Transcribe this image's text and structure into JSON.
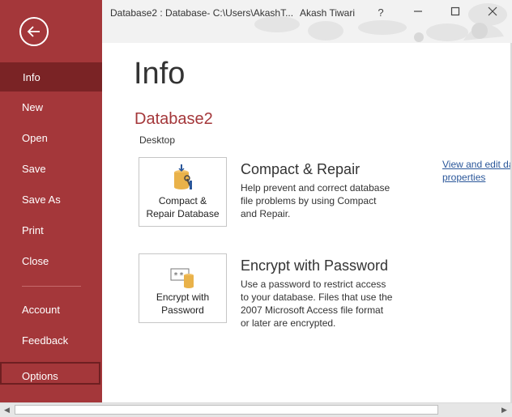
{
  "window": {
    "title": "Database2 : Database- C:\\Users\\AkashT...",
    "user": "Akash Tiwari",
    "help_label": "?",
    "minimize_label": "—",
    "maximize_label": "☐",
    "close_label": "✕"
  },
  "sidebar": {
    "items": [
      {
        "label": "Info"
      },
      {
        "label": "New"
      },
      {
        "label": "Open"
      },
      {
        "label": "Save"
      },
      {
        "label": "Save As"
      },
      {
        "label": "Print"
      },
      {
        "label": "Close"
      },
      {
        "label": "Account"
      },
      {
        "label": "Feedback"
      },
      {
        "label": "Options"
      }
    ],
    "active_index": 0,
    "accent_color": "#a4373a"
  },
  "main": {
    "title": "Info",
    "database_name": "Database2",
    "location": "Desktop",
    "link_text": "View and edit database properties",
    "link_line1": "View and edit da",
    "link_line2": "properties",
    "sections": [
      {
        "tile_label_line1": "Compact &",
        "tile_label_line2": "Repair Database",
        "title": "Compact & Repair",
        "description_lines": [
          "Help prevent and correct database",
          "file problems by using Compact",
          "and Repair."
        ],
        "icon": "compact-repair-icon"
      },
      {
        "tile_label_line1": "Encrypt with",
        "tile_label_line2": "Password",
        "title": "Encrypt with Password",
        "description_lines": [
          "Use a password to restrict access",
          "to your database. Files that use the",
          "2007 Microsoft Access file format",
          "or later are encrypted."
        ],
        "icon": "encrypt-password-icon"
      }
    ]
  },
  "scrollbar": {
    "left_arrow": "◀",
    "right_arrow": "▶"
  }
}
